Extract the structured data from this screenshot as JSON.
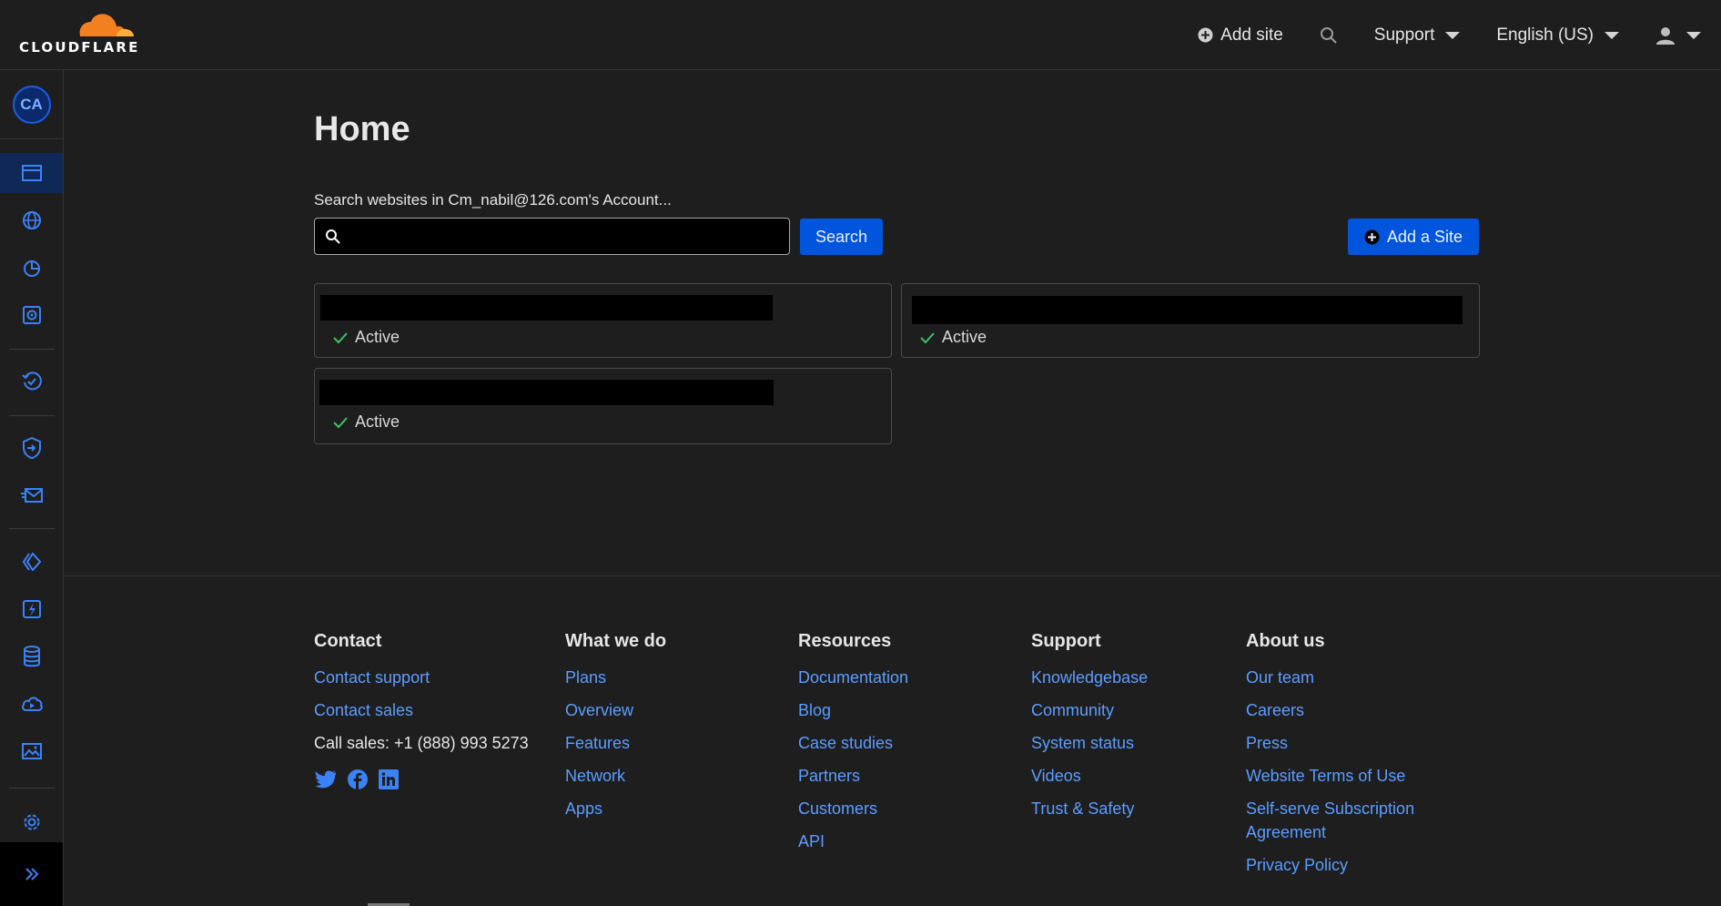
{
  "brand": {
    "name": "CLOUDFLARE",
    "color": "#f48120"
  },
  "topbar": {
    "add_site": "Add site",
    "support": "Support",
    "language": "English (US)"
  },
  "sidebar": {
    "avatar_initials": "CA",
    "items": [
      {
        "icon": "websites-icon",
        "active": true
      },
      {
        "icon": "globe-icon"
      },
      {
        "icon": "analytics-pie-icon"
      },
      {
        "icon": "security-center-icon"
      },
      {
        "icon": "trace-icon"
      },
      {
        "icon": "zero-trust-icon"
      },
      {
        "icon": "email-icon"
      },
      {
        "icon": "pages-icon"
      },
      {
        "icon": "workers-icon"
      },
      {
        "icon": "storage-icon"
      },
      {
        "icon": "stream-cloud-icon"
      },
      {
        "icon": "images-icon"
      },
      {
        "icon": "settings-icon"
      }
    ],
    "expand_icon": "chevrons-right-icon"
  },
  "main": {
    "title": "Home",
    "search_label": "Search websites in Cm_nabil@126.com's Account...",
    "search_placeholder": "",
    "search_button": "Search",
    "add_button": "Add a Site",
    "sites": [
      {
        "status": "Active"
      },
      {
        "status": "Active"
      },
      {
        "status": "Active"
      }
    ]
  },
  "footer": {
    "contact": {
      "heading": "Contact",
      "links": [
        "Contact support",
        "Contact sales"
      ],
      "phone": "Call sales: +1 (888) 993 5273",
      "social": [
        "twitter-icon",
        "facebook-icon",
        "linkedin-icon"
      ]
    },
    "what_we_do": {
      "heading": "What we do",
      "links": [
        "Plans",
        "Overview",
        "Features",
        "Network",
        "Apps"
      ]
    },
    "resources": {
      "heading": "Resources",
      "links": [
        "Documentation",
        "Blog",
        "Case studies",
        "Partners",
        "Customers",
        "API"
      ]
    },
    "support": {
      "heading": "Support",
      "links": [
        "Knowledgebase",
        "Community",
        "System status",
        "Videos",
        "Trust & Safety"
      ]
    },
    "about": {
      "heading": "About us",
      "links": [
        "Our team",
        "Careers",
        "Press",
        "Website Terms of Use",
        "Self-serve Subscription Agreement",
        "Privacy Policy"
      ]
    }
  },
  "colors": {
    "background": "#1e1e1f",
    "accent_blue": "#0055dc",
    "link_blue": "#5c9dff",
    "status_green": "#3fbf6a"
  }
}
